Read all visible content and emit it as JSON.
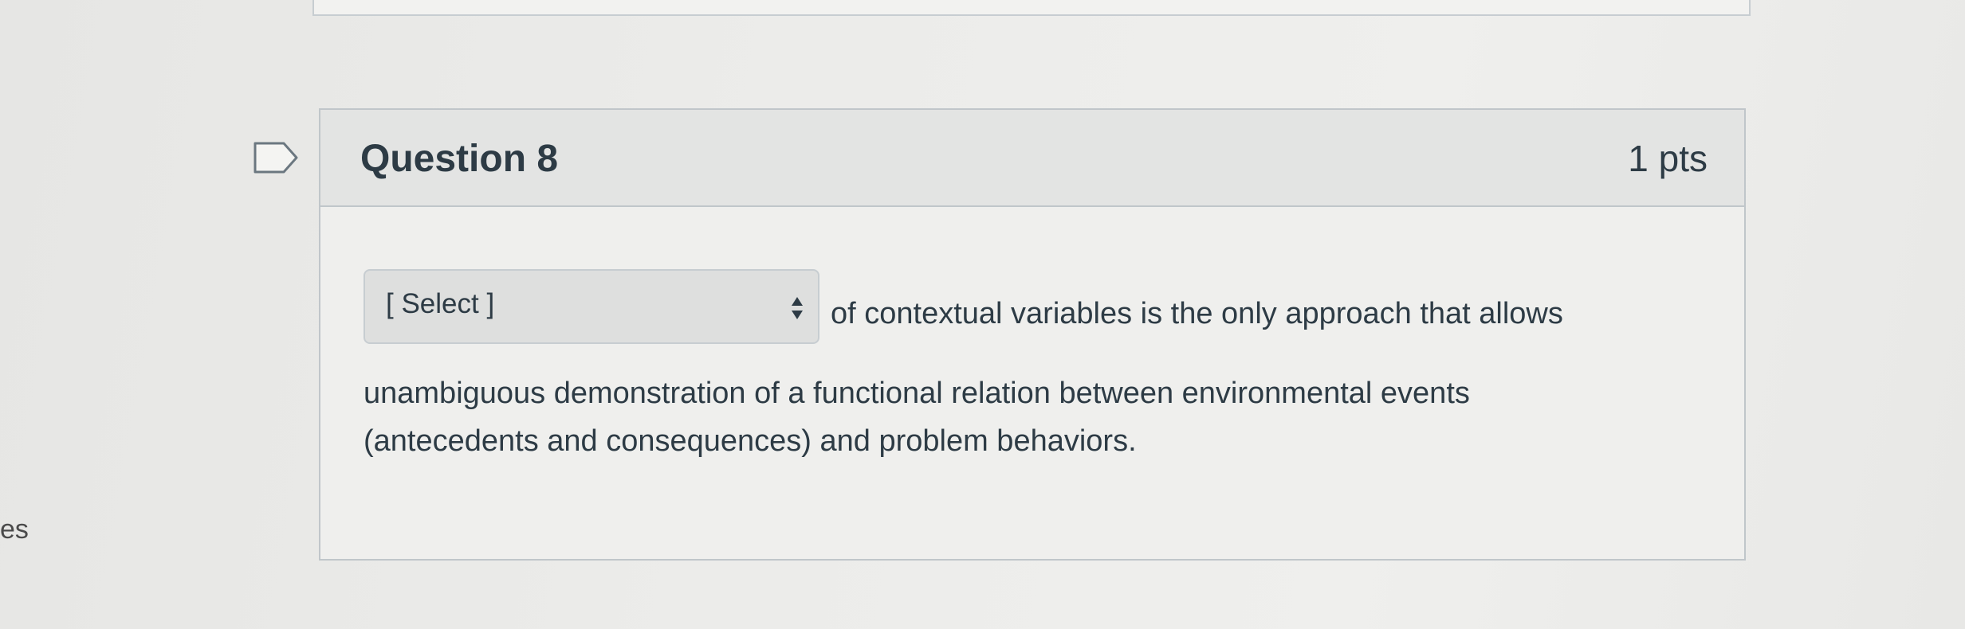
{
  "side_text": "es",
  "question": {
    "title": "Question 8",
    "points": "1 pts",
    "select": {
      "value": "[ Select ]"
    },
    "text_line_1": "of contextual variables is the only approach that allows",
    "text_line_2": "unambiguous demonstration of a functional relation between environmental events",
    "text_line_3": "(antecedents and consequences) and problem behaviors."
  },
  "icons": {
    "flag": "flag-bookmark-icon",
    "select_arrows": "up-down-arrows-icon"
  },
  "colors": {
    "text": "#2d3b45",
    "header_bg": "#e3e4e3",
    "border": "#c0c6ca"
  }
}
